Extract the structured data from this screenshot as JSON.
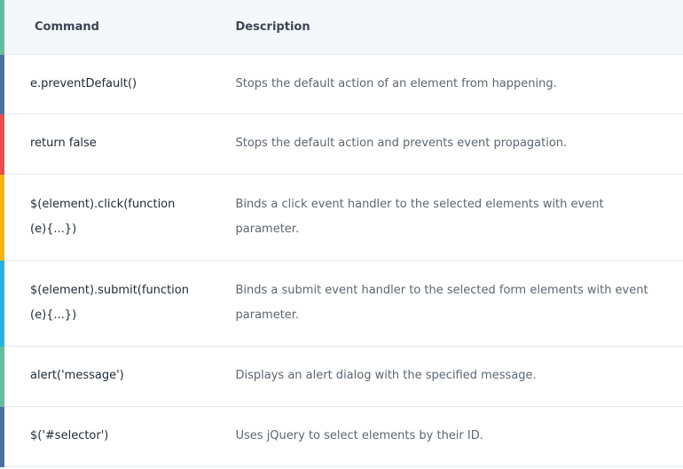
{
  "table": {
    "headers": {
      "command": "Command",
      "description": "Description"
    },
    "rows": [
      {
        "command": "e.preventDefault()",
        "description": "Stops the default action of an element from happening.",
        "accent": "#4a6fa5"
      },
      {
        "command": "return false",
        "description": "Stops the default action and prevents event propagation.",
        "accent": "#ef4b4b"
      },
      {
        "command": "$(element).click(function(e){...})",
        "description": "Binds a click event handler to the selected elements with event parameter.",
        "accent": "#f7b600"
      },
      {
        "command": "$(element).submit(function(e){...})",
        "description": "Binds a submit event handler to the selected form elements with event parameter.",
        "accent": "#1fb5e0"
      },
      {
        "command": "alert('message')",
        "description": "Displays an alert dialog with the specified message.",
        "accent": "#5fbf9f"
      },
      {
        "command": "$('#selector')",
        "description": "Uses jQuery to select elements by their ID.",
        "accent": "#4a6fa5"
      }
    ],
    "header_accent": "#5fbf9f"
  }
}
